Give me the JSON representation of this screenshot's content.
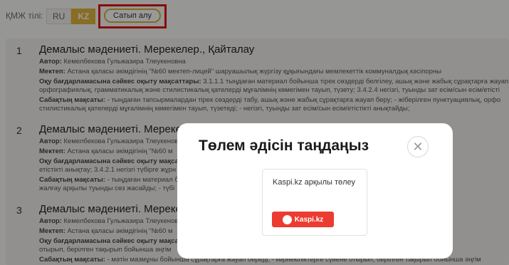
{
  "topbar": {
    "lang_label": "ҚМЖ тілі:",
    "langs": [
      {
        "label": "RU"
      },
      {
        "label": "KZ"
      }
    ],
    "buy_label": "Сатып алу"
  },
  "results": [
    {
      "num": "1",
      "title": "Демалыс мәдениеті. Мерекелер., Қайталау",
      "lines": [
        {
          "k": "Автор:",
          "v": "Кемелбекова Гульжазира Тлеукеновна"
        },
        {
          "k": "Мектеп:",
          "v": "Астана қаласы әкімдігінің \"№60 мектеп-лицей\" шаруашылық жүргізу құқығындағы мемлекеттік коммуналдық кәсіпорны"
        },
        {
          "k": "Оқу бағдарламасына сәйкес оқыту мақсаттары:",
          "v": "3.1.1.1 тыңдаған материал бойынша тірек сөздерді белгілеу, ашық және жабық сұрақтарға жауап бе"
        },
        {
          "k": "",
          "v": "орфографиялық, грамматикалық және стилистикалық қателерді мұғалімнің көмегімен тауып, түзету; 3.4.2.4 негізгі, туынды зат есім/сын есім/етісті"
        },
        {
          "k": "Сабақтың мақсаты:",
          "v": "- тыңдаған тапсырмалардан тірек сөздерді табу, ашық және жабық сұрақтарға жауап беру; - жіберілген пунктуациялық, орфо"
        },
        {
          "k": "",
          "v": "стилистикалық қателерді мұғалімнің көмегімен тауып, түзетеді; - негізгі, туынды зат есім/сын есім/етістікті анықтайды;"
        }
      ]
    },
    {
      "num": "2",
      "title": "Демалыс мәдениеті. Мереке",
      "lines": [
        {
          "k": "Автор:",
          "v": "Кемелбекова Гульжазира Тлеукенов"
        },
        {
          "k": "Мектеп:",
          "v": "Астана қаласы әкімдігінің \"№60 м"
        },
        {
          "k": "Оқу бағдарламасына сәйкес оқыту мақсатт",
          "v": ""
        },
        {
          "k": "",
          "v": "етістікті анықтау; 3.4.2.1 негізгі түбірге жұрн"
        },
        {
          "k": "Сабақтың мақсаты:",
          "v": "- тыңдаған материал б"
        },
        {
          "k": "",
          "v": "жалғау арқылы туынды сөз жасайды; - түбі"
        }
      ]
    },
    {
      "num": "3",
      "title": "Демалыс мәдениеті. Мереке",
      "lines": [
        {
          "k": "Автор:",
          "v": "Кемелбекова Гульжазира Тлеукенов"
        },
        {
          "k": "Мектеп:",
          "v": "Астана қаласы әкімдігінің \"№60 м"
        },
        {
          "k": "Оқу бағдарламасына сәйкес оқыту мақсатт",
          "v": ""
        },
        {
          "k": "",
          "v": "отырып, берілген тақырып бойынша әңгім"
        },
        {
          "k": "Сабақтың мақсаты:",
          "v": "- мәтін мазмұны бойынша сұрақтарға жауап береді; - көрнекіліктерге сүйене отырып, берілген тақырып бойынша әңгім"
        }
      ]
    }
  ],
  "modal": {
    "title": "Төлем әдісін таңдаңыз",
    "close_icon": "close-icon",
    "payment_label": "Kaspi.kz арқылы төлеу",
    "kaspi_logo_text": "Kaspi.kz",
    "brand_color": "#ec3b31"
  },
  "accent_color": "#e3b63a"
}
